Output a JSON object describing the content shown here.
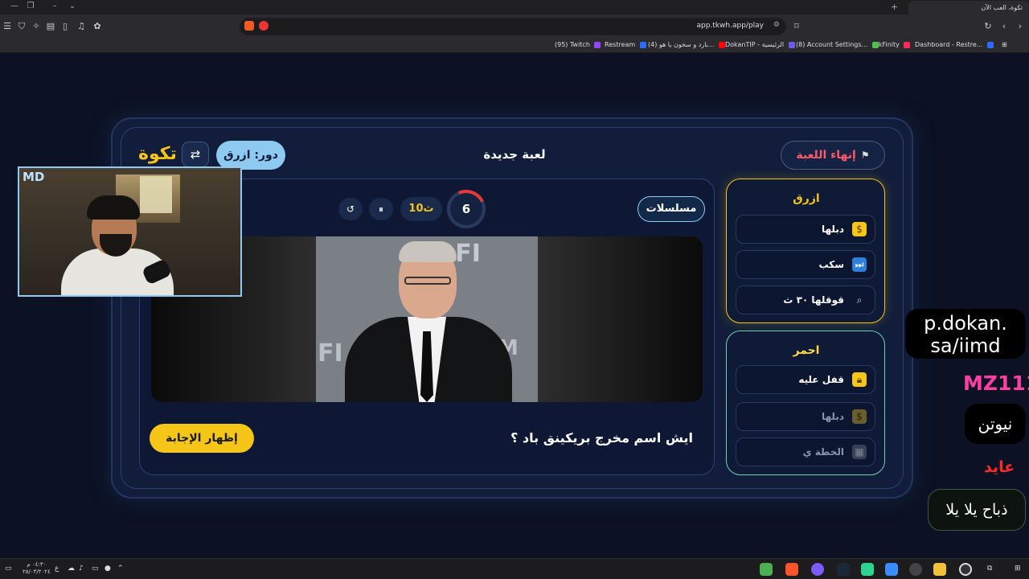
{
  "browser": {
    "tab_title": "تكوة، العب الآن",
    "url": "app.tkwh.app/play",
    "bookmarks": [
      {
        "label": "Dashboard - Restre...",
        "color": "#2e6bff"
      },
      {
        "label": "TikFinity",
        "color": "#ff2d55"
      },
      {
        "label": "(8) Account Settings...",
        "color": "#4cc24c"
      },
      {
        "label": "DokanTIP - الرئيسية",
        "color": "#6c5ce7"
      },
      {
        "label": "(4) بارد و سخون يا هو...",
        "color": "#ff0000"
      },
      {
        "label": "Restream",
        "color": "#2e6bff"
      },
      {
        "label": "(95) Twitch",
        "color": "#9146ff"
      }
    ]
  },
  "game": {
    "logo": "تكوة",
    "swap_icon": "⇄",
    "turn_label": "دور: ازرق",
    "new_game": "لعبة جديدة",
    "end_game": "إنهاء اللعبة",
    "category": "مسلسلات",
    "timer_remaining": "6",
    "time_setting": "10ث",
    "pause_icon": "⏸",
    "reset_icon": "↺",
    "question": "ايش اسم مخرج بريكينق باد ؟",
    "reveal_button": "إظهار الإجابة",
    "photo_text": "AFI"
  },
  "teams": {
    "blue": {
      "name": "ازرق",
      "lifelines": [
        {
          "label": "دبلها",
          "icon": "💰"
        },
        {
          "label": "سكب",
          "icon": "⏭"
        },
        {
          "label": "قوقلها ٣٠ ث",
          "icon": "🔍"
        }
      ]
    },
    "red": {
      "name": "احمر",
      "lifelines": [
        {
          "label": "قفل عليه",
          "icon": "🔒"
        },
        {
          "label": "دبلها",
          "icon": "💰"
        },
        {
          "label": "الخطة ي",
          "icon": "▦"
        }
      ]
    }
  },
  "webcam": {
    "overlay_logo": "MD"
  },
  "chat": {
    "message_1": "p.dokan.\nsa/iimd",
    "user_1": "MZ111",
    "message_2": "نيوتن",
    "user_2": "عايد",
    "message_3": "ذباح يلا يلا"
  },
  "taskbar": {
    "clock_time": "٠٤:٣٠ م",
    "clock_date": "٢٥/٠٣/٢٠٢٤",
    "lang": "ع"
  },
  "colors": {
    "accent_yellow": "#f5c518",
    "blue_team": "#8ec9f2",
    "red_team_text": "#ff5a6a",
    "red_team_border": "#6fd0b6",
    "timer_arc": "#e5383b"
  }
}
